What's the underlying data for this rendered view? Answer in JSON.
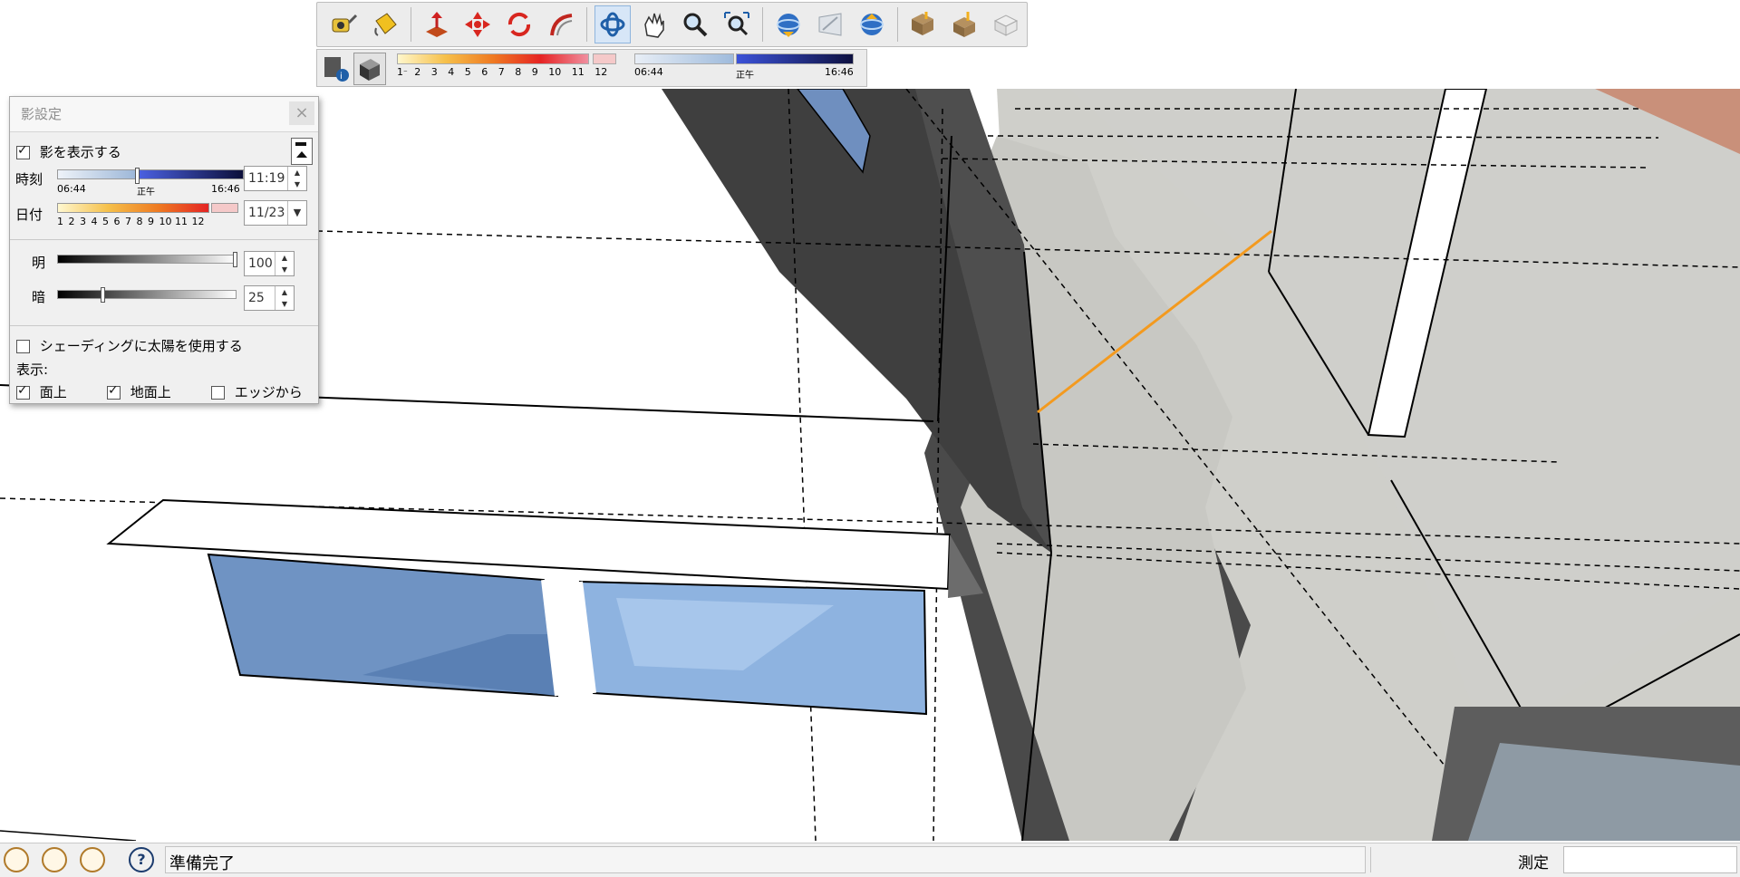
{
  "shadow_panel": {
    "title": "影設定",
    "close_glyph": "×",
    "show_shadows_label": "影を表示する",
    "show_shadows_checked": true,
    "time": {
      "label": "時刻",
      "value": "11:19",
      "scale_start": "06:44",
      "scale_mid": "正午",
      "scale_end": "16:46",
      "position_fraction": 0.45
    },
    "date": {
      "label": "日付",
      "value": "11/23",
      "months": [
        "1",
        "2",
        "3",
        "4",
        "5",
        "6",
        "7",
        "8",
        "9",
        "10",
        "11",
        "12"
      ]
    },
    "light": {
      "label": "明",
      "value": "100",
      "fraction": 1.0
    },
    "dark": {
      "label": "暗",
      "value": "25",
      "fraction": 0.25
    },
    "use_sun_label": "シェーディングに太陽を使用する",
    "use_sun_checked": false,
    "display_label": "表示:",
    "on_faces_label": "面上",
    "on_faces_checked": true,
    "on_ground_label": "地面上",
    "on_ground_checked": true,
    "from_edges_label": "エッジから",
    "from_edges_checked": false
  },
  "shadow_toolbar": {
    "months_first": "1",
    "months_rest": [
      "2",
      "3",
      "4",
      "5",
      "6",
      "7",
      "8",
      "9",
      "10",
      "11",
      "12"
    ],
    "time_start": "06:44",
    "time_mid": "正午",
    "time_end": "16:46"
  },
  "toolbar": {
    "icons": [
      "tape-measure-icon",
      "paint-bucket-icon",
      "push-pull-icon",
      "move-icon",
      "rotate-icon",
      "follow-me-icon",
      "orbit-icon",
      "pan-icon",
      "zoom-icon",
      "zoom-extents-icon",
      "get-models-icon",
      "share-model-icon",
      "3d-warehouse-icon",
      "get-component-icon",
      "share-component-icon",
      "extension-icon"
    ]
  },
  "status": {
    "text": "準備完了",
    "measure_label": "測定",
    "measure_value": ""
  },
  "colors": {
    "accent_orange": "#f39a1f",
    "window_blue": "#6f93c3",
    "shadow_dark": "#4b4b4b",
    "shadow_light": "#c9c9c4"
  }
}
